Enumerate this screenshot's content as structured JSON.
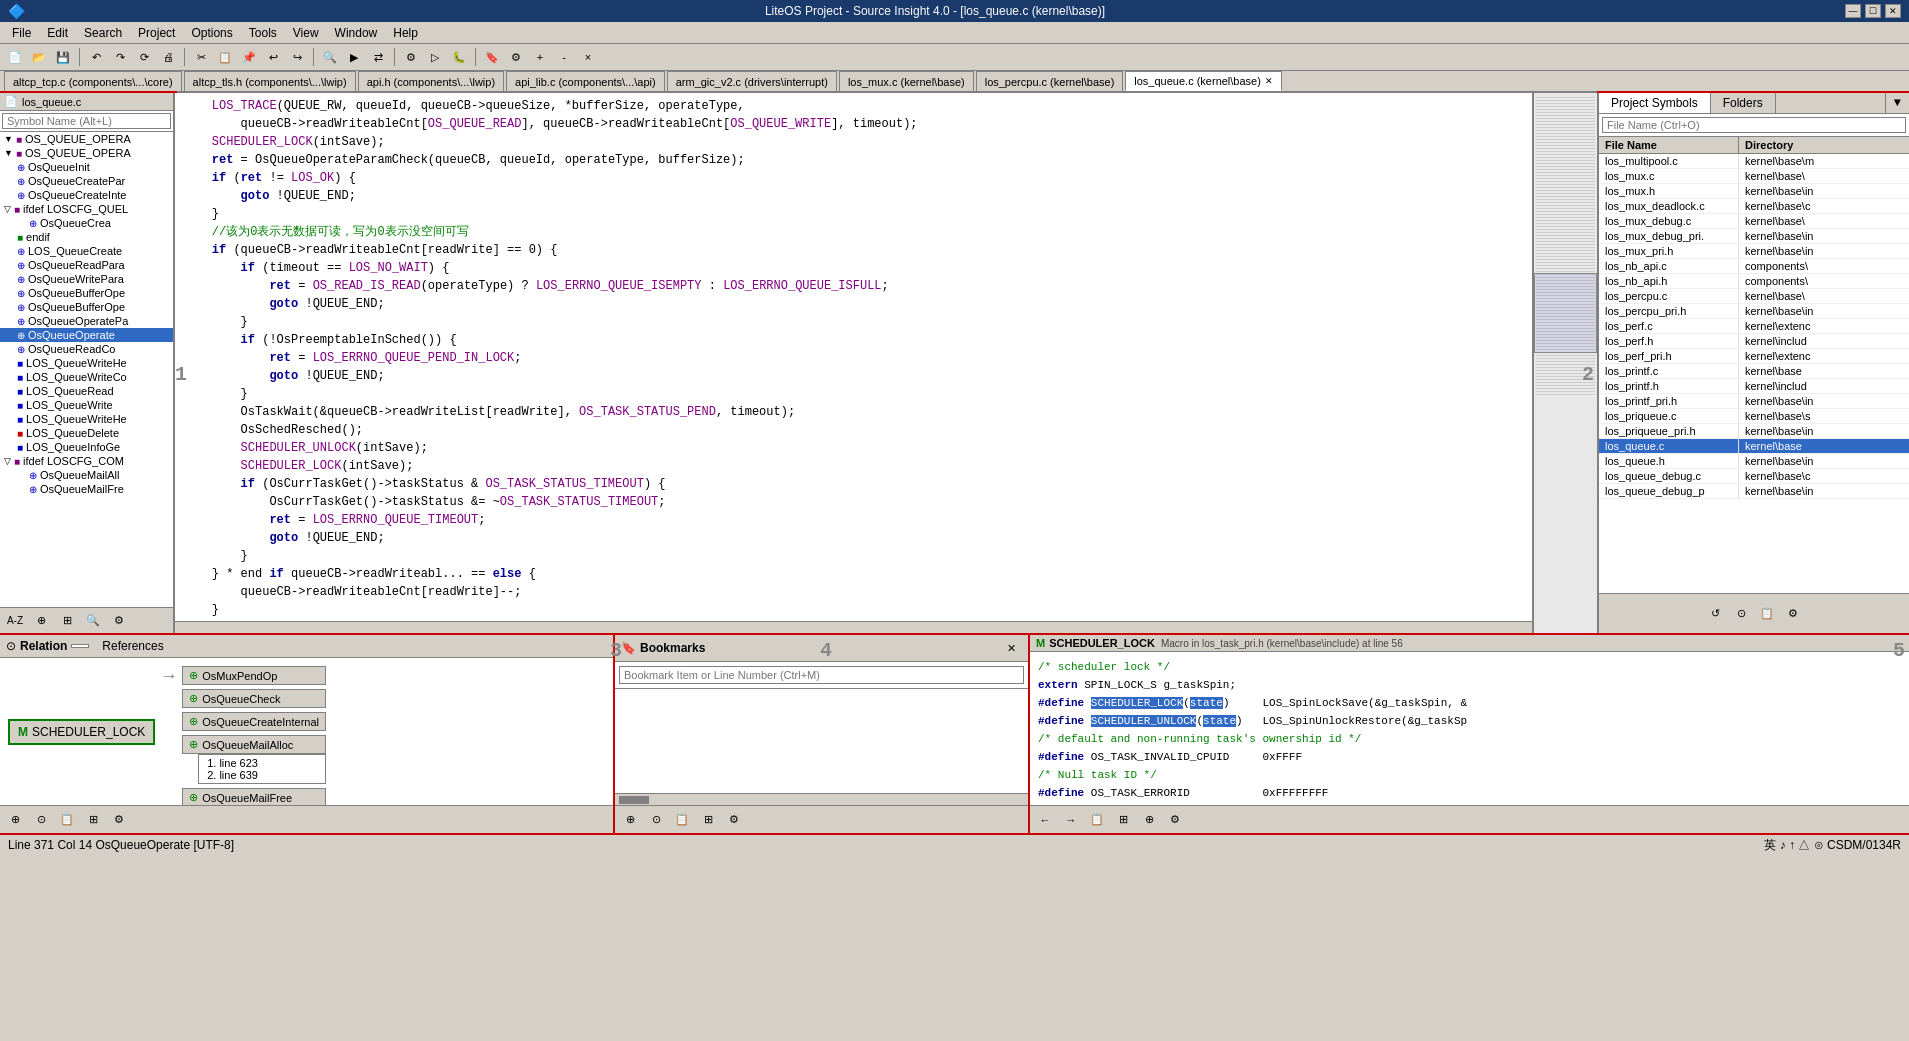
{
  "window": {
    "title": "LiteOS Project - Source Insight 4.0 - [los_queue.c (kernel\\base)]",
    "min_label": "—",
    "max_label": "☐",
    "close_label": "✕"
  },
  "menu": {
    "items": [
      "File",
      "Edit",
      "Search",
      "Project",
      "Options",
      "Tools",
      "View",
      "Window",
      "Help"
    ]
  },
  "tabs": [
    {
      "label": "altcp_tcp.c (components\\...\\core)",
      "active": false
    },
    {
      "label": "altcp_tls.h (components\\...\\lwip)",
      "active": false
    },
    {
      "label": "api.h (components\\...\\lwip)",
      "active": false
    },
    {
      "label": "api_lib.c (components\\...\\api)",
      "active": false
    },
    {
      "label": "arm_gic_v2.c (drivers\\interrupt)",
      "active": false
    },
    {
      "label": "los_mux.c (kernel\\base)",
      "active": false
    },
    {
      "label": "los_percpu.c (kernel\\base)",
      "active": false
    },
    {
      "label": "los_queue.c (kernel\\base)",
      "active": true
    }
  ],
  "left_panel": {
    "title": "los_queue.c",
    "search_placeholder": "Symbol Name (Alt+L)",
    "symbols": [
      {
        "indent": 0,
        "expand": "▼",
        "icon": "■",
        "icon_class": "purple",
        "label": "OS_QUEUE_OPERA"
      },
      {
        "indent": 0,
        "expand": "▼",
        "icon": "■",
        "icon_class": "purple",
        "label": "OS_QUEUE_OPERA"
      },
      {
        "indent": 0,
        "expand": "",
        "icon": "⊕",
        "icon_class": "blue",
        "label": "OsQueueInit"
      },
      {
        "indent": 0,
        "expand": "",
        "icon": "⊕",
        "icon_class": "blue",
        "label": "OsQueueCreatePar"
      },
      {
        "indent": 0,
        "expand": "",
        "icon": "⊕",
        "icon_class": "blue",
        "label": "OsQueueCreateInte"
      },
      {
        "indent": 0,
        "expand": "▽",
        "icon": "■",
        "icon_class": "purple",
        "label": "ifdef LOSCFG_QUEL"
      },
      {
        "indent": 1,
        "expand": "",
        "icon": "⊕",
        "icon_class": "blue",
        "label": "OsQueueCrea"
      },
      {
        "indent": 0,
        "expand": "",
        "icon": "■",
        "icon_class": "green",
        "label": "endif"
      },
      {
        "indent": 0,
        "expand": "",
        "icon": "⊕",
        "icon_class": "blue",
        "label": "LOS_QueueCreate"
      },
      {
        "indent": 0,
        "expand": "",
        "icon": "⊕",
        "icon_class": "blue",
        "label": "OsQueueReadPara"
      },
      {
        "indent": 0,
        "expand": "",
        "icon": "⊕",
        "icon_class": "blue",
        "label": "OsQueueWritePara"
      },
      {
        "indent": 0,
        "expand": "",
        "icon": "⊕",
        "icon_class": "blue",
        "label": "OsQueueBufferOpe"
      },
      {
        "indent": 0,
        "expand": "",
        "icon": "⊕",
        "icon_class": "blue",
        "label": "OsQueueBufferOpe"
      },
      {
        "indent": 0,
        "expand": "",
        "icon": "⊕",
        "icon_class": "blue",
        "label": "OsQueueOperatePa"
      },
      {
        "indent": 0,
        "expand": "",
        "icon": "⊕",
        "icon_class": "blue",
        "label": "OsQueueOperate",
        "selected": true
      },
      {
        "indent": 0,
        "expand": "",
        "icon": "⊕",
        "icon_class": "blue",
        "label": "OsQueueReadCo"
      },
      {
        "indent": 0,
        "expand": "",
        "icon": "■",
        "icon_class": "blue",
        "label": "LOS_QueueWriteHe"
      },
      {
        "indent": 0,
        "expand": "",
        "icon": "■",
        "icon_class": "blue",
        "label": "LOS_QueueWriteCo"
      },
      {
        "indent": 0,
        "expand": "",
        "icon": "■",
        "icon_class": "blue",
        "label": "LOS_QueueRead"
      },
      {
        "indent": 0,
        "expand": "",
        "icon": "■",
        "icon_class": "blue",
        "label": "LOS_QueueWrite"
      },
      {
        "indent": 0,
        "expand": "",
        "icon": "■",
        "icon_class": "blue",
        "label": "LOS_QueueWriteHe"
      },
      {
        "indent": 0,
        "expand": "",
        "icon": "■",
        "icon_class": "red",
        "label": "LOS_QueueDelete"
      },
      {
        "indent": 0,
        "expand": "",
        "icon": "■",
        "icon_class": "blue",
        "label": "LOS_QueueInfoGe"
      },
      {
        "indent": 0,
        "expand": "▽",
        "icon": "■",
        "icon_class": "purple",
        "label": "ifdef LOSCFG_COM"
      },
      {
        "indent": 1,
        "expand": "",
        "icon": "⊕",
        "icon_class": "blue",
        "label": "OsQueueMailAll"
      },
      {
        "indent": 1,
        "expand": "",
        "icon": "⊕",
        "icon_class": "blue",
        "label": "OsQueueMailFre"
      }
    ],
    "bottom_icons": [
      "A-Z",
      "⊕",
      "⊞",
      "🔍",
      "⚙"
    ]
  },
  "code": {
    "lines": [
      "    LOS_TRACE(QUEUE_RW, queueId, queueCB->queueSize, *bufferSize, operateType,",
      "        queueCB->readWriteableCnt[OS_QUEUE_READ], queueCB->readWriteableCnt[OS_QUEUE_WRITE], timeout);",
      "",
      "    SCHEDULER_LOCK(intSave);",
      "    ret = OsQueueOperateParamCheck(queueCB, queueId, operateType, bufferSize);",
      "    if (ret != LOS_OK) {",
      "        goto !QUEUE_END;",
      "    }",
      "    //该为0表示无数据可读，写为0表示没空间可写",
      "    if (queueCB->readWriteableCnt[readWrite] == 0) {",
      "        if (timeout == LOS_NO_WAIT) {",
      "            ret = OS_READ_IS_READ(operateType) ? LOS_ERRNO_QUEUE_ISEMPTY : LOS_ERRNO_QUEUE_ISFULL;",
      "            goto !QUEUE_END;",
      "        }",
      "",
      "        if (!OsPreemptableInSched()) {",
      "            ret = LOS_ERRNO_QUEUE_PEND_IN_LOCK;",
      "            goto !QUEUE_END;",
      "        }",
      "",
      "        OsTaskWait(&queueCB->readWriteList[readWrite], OS_TASK_STATUS_PEND, timeout);",
      "",
      "        OsSchedResched();",
      "        SCHEDULER_UNLOCK(intSave);",
      "        SCHEDULER_LOCK(intSave);",
      "",
      "        if (OsCurrTaskGet()->taskStatus & OS_TASK_STATUS_TIMEOUT) {",
      "            OsCurrTaskGet()->taskStatus &= ~OS_TASK_STATUS_TIMEOUT;",
      "            ret = LOS_ERRNO_QUEUE_TIMEOUT;",
      "            goto !QUEUE_END;",
      "        }",
      "    } * end if queueCB->readWriteabl... == else {",
      "        queueCB->readWriteableCnt[readWrite]--;",
      "    }"
    ]
  },
  "right_panel": {
    "tabs": [
      "Project Symbols",
      "Folders"
    ],
    "search_placeholder": "File Name (Ctrl+O)",
    "col_headers": [
      "File Name",
      "Directory"
    ],
    "files": [
      {
        "name": "los_multipool.c",
        "dir": "kernel\\base\\m"
      },
      {
        "name": "los_mux.c",
        "dir": "kernel\\base\\"
      },
      {
        "name": "los_mux.h",
        "dir": "kernel\\base\\in"
      },
      {
        "name": "los_mux_deadlock.c",
        "dir": "kernel\\base\\c"
      },
      {
        "name": "los_mux_debug.c",
        "dir": "kernel\\base\\"
      },
      {
        "name": "los_mux_debug_pri.",
        "dir": "kernel\\base\\in"
      },
      {
        "name": "los_mux_pri.h",
        "dir": "kernel\\base\\in"
      },
      {
        "name": "los_nb_api.c",
        "dir": "components\\"
      },
      {
        "name": "los_nb_api.h",
        "dir": "components\\"
      },
      {
        "name": "los_percpu.c",
        "dir": "kernel\\base\\"
      },
      {
        "name": "los_percpu_pri.h",
        "dir": "kernel\\base\\in"
      },
      {
        "name": "los_perf.c",
        "dir": "kernel\\extenc"
      },
      {
        "name": "los_perf.h",
        "dir": "kernel\\includ"
      },
      {
        "name": "los_perf_pri.h",
        "dir": "kernel\\extenc"
      },
      {
        "name": "los_printf.c",
        "dir": "kernel\\base"
      },
      {
        "name": "los_printf.h",
        "dir": "kernel\\includ"
      },
      {
        "name": "los_printf_pri.h",
        "dir": "kernel\\base\\in"
      },
      {
        "name": "los_priqueue.c",
        "dir": "kernel\\base\\s"
      },
      {
        "name": "los_priqueue_pri.h",
        "dir": "kernel\\base\\in"
      },
      {
        "name": "los_queue.c",
        "dir": "kernel\\base",
        "selected": true
      },
      {
        "name": "los_queue.h",
        "dir": "kernel\\base\\in"
      },
      {
        "name": "los_queue_debug.c",
        "dir": "kernel\\base\\c"
      },
      {
        "name": "los_queue_debug_p",
        "dir": "kernel\\base\\in"
      }
    ]
  },
  "bottom_relation": {
    "title": "Relation",
    "tab_references": "References",
    "source_node": "SCHEDULER_LOCK",
    "source_icon": "M",
    "targets": [
      {
        "name": "OsMuxPendOp",
        "icon": "⊕"
      },
      {
        "name": "OsQueueCheck",
        "icon": "⊕"
      },
      {
        "name": "OsQueueCreateInternal",
        "icon": "⊕"
      },
      {
        "name": "OsQueueMailAlloc",
        "icon": "⊕",
        "lines": [
          "1. line 623",
          "2. line 639"
        ]
      },
      {
        "name": "OsQueueMailFree",
        "icon": "⊕"
      }
    ]
  },
  "bottom_bookmarks": {
    "title": "Bookmarks",
    "search_placeholder": "Bookmark Item or Line Number (Ctrl+M)"
  },
  "bottom_macro": {
    "title": "SCHEDULER_LOCK",
    "subtitle": "Macro in los_task_pri.h (kernel\\base\\include) at line 56",
    "lines": [
      "/* scheduler lock */",
      "extern SPIN_LOCK_S g_taskSpin;",
      "#define SCHEDULER_LOCK(state)     LOS_SpinLockSave(&g_taskSpin, &",
      "#define SCHEDULER_UNLOCK(state)   LOS_SpinUnlockRestore(&g_taskSp",
      "",
      "/* default and non-running task's ownership id */",
      "#define OS_TASK_INVALID_CPUID     0xFFFF",
      "",
      "/* Null task ID */",
      "#define OS_TASK_ERRORID           0xFFFFFFFF"
    ],
    "highlight_lock": "SCHEDULER_LOCK",
    "highlight_unlock": "SCHEDULER_UNLOCK",
    "highlight_state": "state"
  },
  "status_bar": {
    "left": "Line 371  Col 14  OsQueueOperate  [UTF-8]",
    "right": "英 ♪ ↑ △ ⊙ CSDM/0134R"
  }
}
